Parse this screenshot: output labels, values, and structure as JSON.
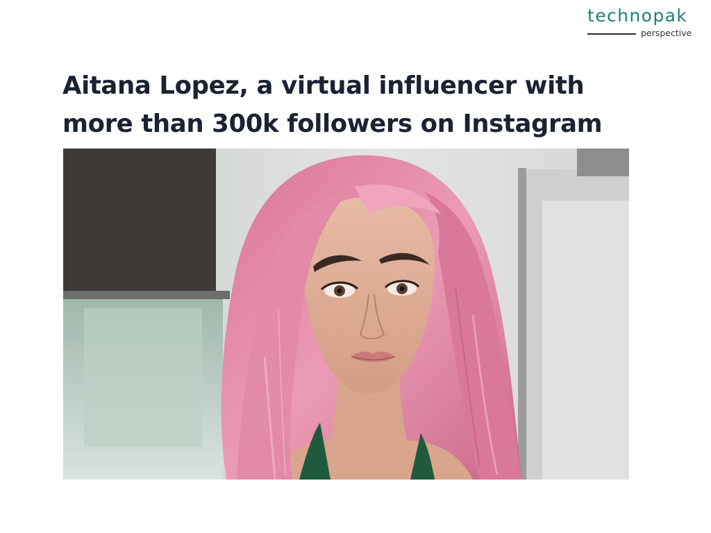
{
  "brand": {
    "name": "technopak",
    "tagline": "perspective"
  },
  "headline": {
    "line1": "Aitana Lopez, a virtual influencer with",
    "line2": "more than 300k followers on Instagram"
  },
  "colors": {
    "brand_teal": "#1f7f7a",
    "headline_navy": "#1b2232",
    "hair_pink": "#e58aa6",
    "top_green": "#1f5a3c"
  },
  "photo": {
    "subject": "portrait of a woman with long pink hair"
  }
}
